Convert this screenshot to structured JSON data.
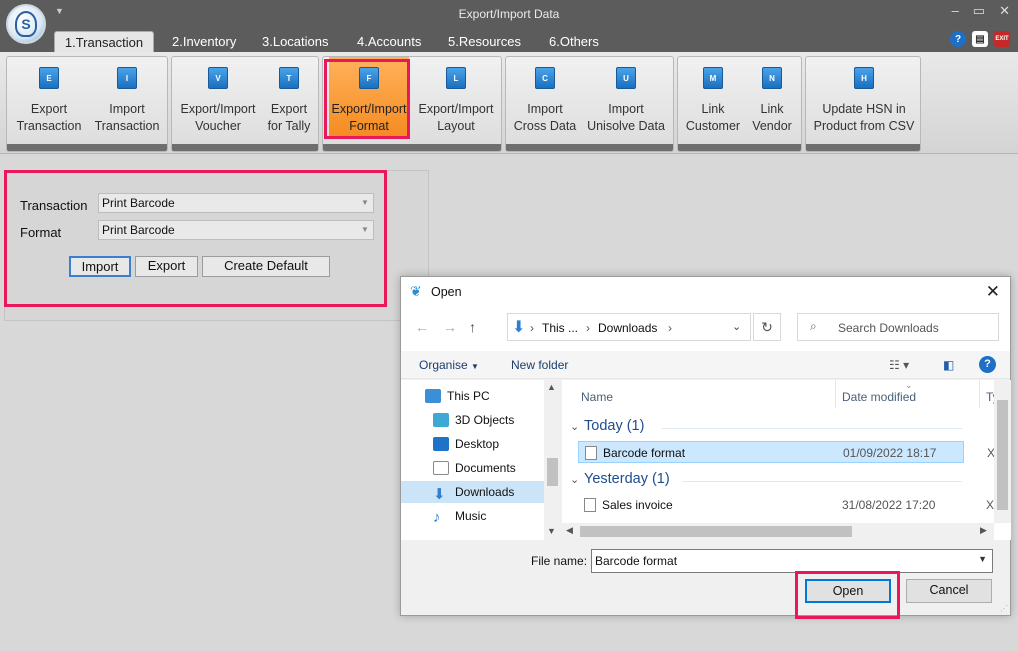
{
  "app": {
    "title": "Export/Import Data",
    "logo_letter": "S"
  },
  "window_controls": {
    "minimize": "–",
    "maximize": "▭",
    "close": "✕"
  },
  "tabs": [
    {
      "label": "1.Transaction",
      "active": true
    },
    {
      "label": "2.Inventory"
    },
    {
      "label": "3.Locations"
    },
    {
      "label": "4.Accounts"
    },
    {
      "label": "5.Resources"
    },
    {
      "label": "6.Others"
    }
  ],
  "tab_icons": {
    "help": "?",
    "doc": "▤",
    "exit": "EXIT"
  },
  "ribbon": {
    "buttons": [
      {
        "line1": "Export",
        "line2": "Transaction",
        "icon": "E"
      },
      {
        "line1": "Import",
        "line2": "Transaction",
        "icon": "I"
      },
      {
        "line1": "Export/Import",
        "line2": "Voucher",
        "icon": "V"
      },
      {
        "line1": "Export",
        "line2": "for Tally",
        "icon": "T"
      },
      {
        "line1": "Export/Import",
        "line2": "Format",
        "icon": "F",
        "selected": true
      },
      {
        "line1": "Export/Import",
        "line2": "Layout",
        "icon": "L"
      },
      {
        "line1": "Import",
        "line2": "Cross Data",
        "icon": "C"
      },
      {
        "line1": "Import",
        "line2": "Unisolve Data",
        "icon": "U"
      },
      {
        "line1": "Link",
        "line2": "Customer",
        "icon": "M"
      },
      {
        "line1": "Link",
        "line2": "Vendor",
        "icon": "N"
      },
      {
        "line1": "Update HSN in",
        "line2": "Product from CSV",
        "icon": "H"
      }
    ]
  },
  "panel": {
    "transaction_label": "Transaction",
    "transaction_value": "Print Barcode",
    "format_label": "Format",
    "format_value": "Print Barcode",
    "import_button": "Import",
    "export_button": "Export",
    "create_default_button": "Create Default"
  },
  "dialog": {
    "title": "Open",
    "close": "✕",
    "address": {
      "part1": "This ...",
      "part2": "Downloads"
    },
    "search_placeholder": "Search Downloads",
    "organise": "Organise",
    "new_folder": "New folder",
    "help": "?",
    "tree": [
      {
        "label": "This PC",
        "icon": "pc-icon",
        "color": "#3b8fd6"
      },
      {
        "label": "3D Objects",
        "icon": "cube-icon",
        "color": "#3fa9d6"
      },
      {
        "label": "Desktop",
        "icon": "desktop-icon",
        "color": "#1e73c8"
      },
      {
        "label": "Documents",
        "icon": "documents-icon",
        "color": "#8a8a8a"
      },
      {
        "label": "Downloads",
        "icon": "download-icon",
        "color": "#2f7fd4",
        "selected": true
      },
      {
        "label": "Music",
        "icon": "music-icon",
        "color": "#2a7fd1"
      }
    ],
    "columns": {
      "name": "Name",
      "date": "Date modified",
      "type": "Ty"
    },
    "groups": [
      {
        "label": "Today (1)",
        "files": [
          {
            "name": "Barcode format",
            "date": "01/09/2022 18:17",
            "type": "X",
            "selected": true
          }
        ]
      },
      {
        "label": "Yesterday (1)",
        "files": [
          {
            "name": "Sales invoice",
            "date": "31/08/2022 17:20",
            "type": "X"
          }
        ]
      }
    ],
    "file_name_label": "File name:",
    "file_name_value": "Barcode format",
    "open_button": "Open",
    "cancel_button": "Cancel"
  },
  "colors": {
    "highlight": "#e8185b",
    "selected_ribbon": "#f58a1f",
    "titlebar": "#5c5c5c",
    "link_blue": "#1f4e8c"
  }
}
